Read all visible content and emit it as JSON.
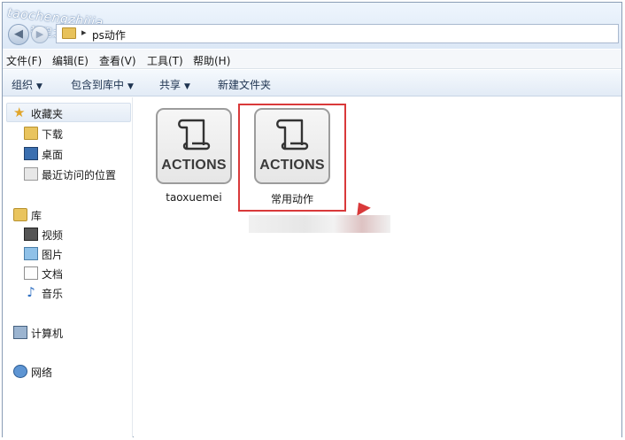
{
  "watermark": {
    "line1": "taochengzhijia",
    "line2": "教程之家"
  },
  "address": {
    "segments": [
      "ps动作"
    ],
    "separator": "▸"
  },
  "menubar": {
    "items": [
      "文件(F)",
      "编辑(E)",
      "查看(V)",
      "工具(T)",
      "帮助(H)"
    ]
  },
  "toolbar": {
    "organize": "组织",
    "include_in_library": "包含到库中",
    "share": "共享",
    "new_folder": "新建文件夹"
  },
  "sidebar": {
    "favorites": {
      "label": "收藏夹",
      "items": [
        "下载",
        "桌面",
        "最近访问的位置"
      ]
    },
    "libraries": {
      "label": "库",
      "items": [
        "视频",
        "图片",
        "文档",
        "音乐"
      ]
    },
    "computer": "计算机",
    "network": "网络"
  },
  "files": [
    {
      "icon_text": "ACTIONS",
      "name": "taoxuemei",
      "icon": "actions-scroll-icon"
    },
    {
      "icon_text": "ACTIONS",
      "name": "常用动作",
      "icon": "actions-scroll-icon",
      "highlighted": true
    }
  ],
  "colors": {
    "highlight": "#d9393a",
    "toolbar_text": "#1e3350"
  }
}
